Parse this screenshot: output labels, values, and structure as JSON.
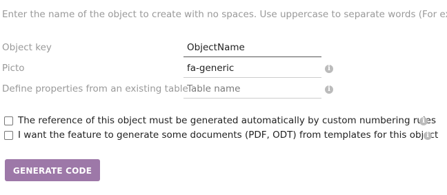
{
  "intro_text": "Enter the name of the object to create with no spaces. Use uppercase to separate words (For example",
  "fields": [
    {
      "label": "Object key",
      "value": "ObjectName",
      "placeholder": "",
      "has_info": false
    },
    {
      "label": "Picto",
      "value": "fa-generic",
      "placeholder": "",
      "has_info": true,
      "info_icon": "info-circle-icon"
    },
    {
      "label": "Define properties from an existing table",
      "value": "",
      "placeholder": "Table name",
      "has_info": true,
      "info_icon": "info-circle-icon"
    }
  ],
  "checkboxes": [
    {
      "label": "The reference of this object must be generated automatically by custom numbering rules",
      "checked": false,
      "info_icon": "info-circle-icon"
    },
    {
      "label": "I want the feature to generate some documents (PDF, ODT) from templates for this object",
      "checked": false,
      "info_icon": "info-circle-icon"
    }
  ],
  "info_glyph": "i",
  "generate_button": {
    "label": "GENERATE CODE"
  },
  "colors": {
    "button": "#9d78a8",
    "label": "#999999",
    "info_icon": "#bbbbbb"
  }
}
